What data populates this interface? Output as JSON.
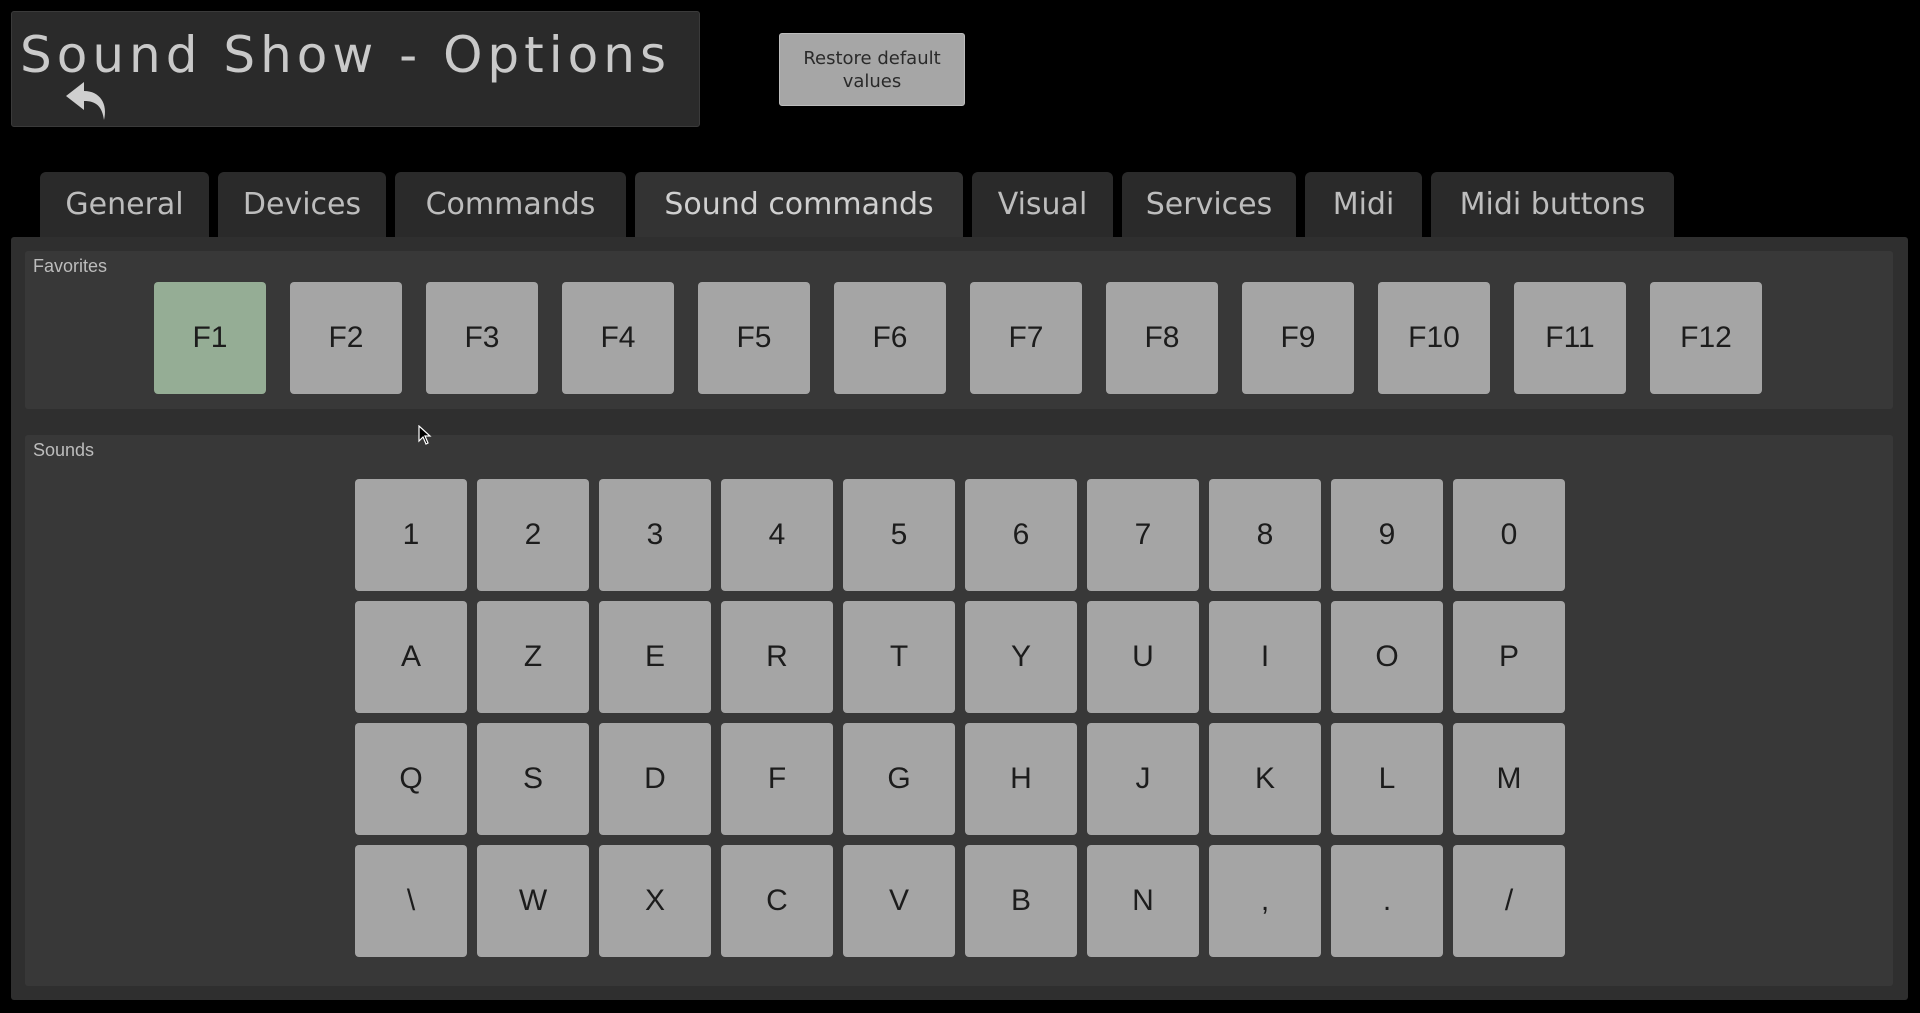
{
  "header": {
    "title": "Sound Show - Options",
    "back_icon": "undo-arrow-icon",
    "restore_label": "Restore default values"
  },
  "tabs": [
    {
      "label": "General"
    },
    {
      "label": "Devices"
    },
    {
      "label": "Commands"
    },
    {
      "label": "Sound commands",
      "active": true
    },
    {
      "label": "Visual"
    },
    {
      "label": "Services"
    },
    {
      "label": "Midi"
    },
    {
      "label": "Midi buttons"
    }
  ],
  "favorites": {
    "label": "Favorites",
    "keys": [
      "F1",
      "F2",
      "F3",
      "F4",
      "F5",
      "F6",
      "F7",
      "F8",
      "F9",
      "F10",
      "F11",
      "F12"
    ],
    "selected": "F1"
  },
  "sounds": {
    "label": "Sounds",
    "rows": [
      [
        "1",
        "2",
        "3",
        "4",
        "5",
        "6",
        "7",
        "8",
        "9",
        "0"
      ],
      [
        "A",
        "Z",
        "E",
        "R",
        "T",
        "Y",
        "U",
        "I",
        "O",
        "P"
      ],
      [
        "Q",
        "S",
        "D",
        "F",
        "G",
        "H",
        "J",
        "K",
        "L",
        "M"
      ],
      [
        "\\",
        "W",
        "X",
        "C",
        "V",
        "B",
        "N",
        ",",
        ".",
        "/"
      ]
    ]
  },
  "colors": {
    "background": "#000000",
    "panel": "#2f2f2f",
    "key": "#a5a5a5",
    "key_selected": "#95ad95"
  }
}
